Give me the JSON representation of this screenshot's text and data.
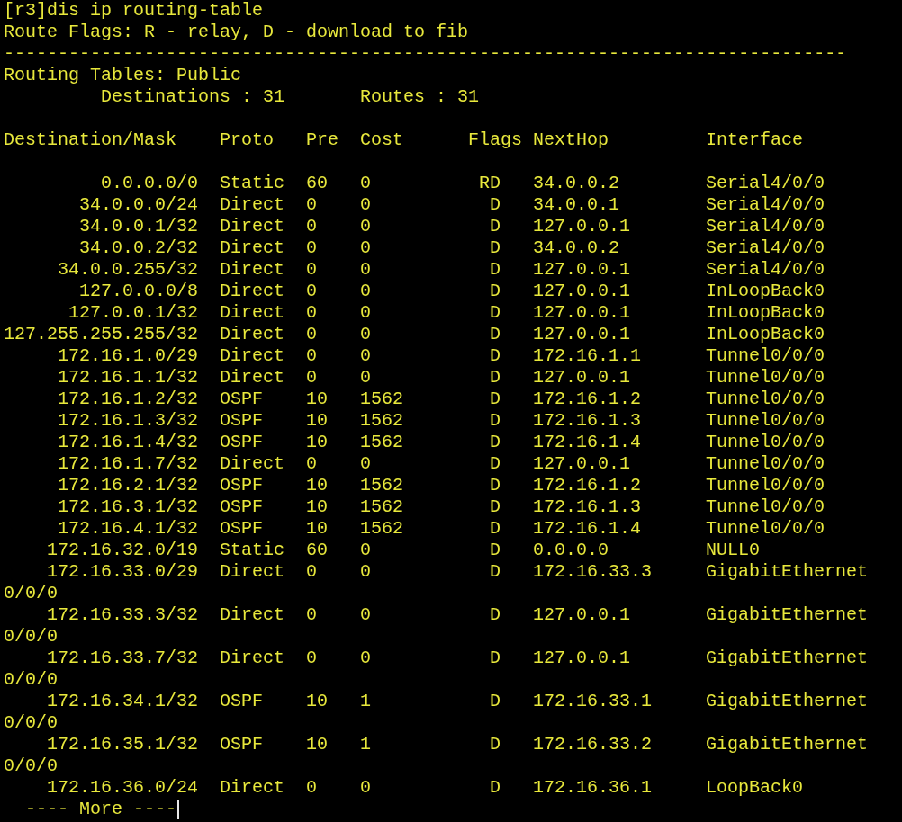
{
  "terminal": {
    "command": "[r3]dis ip routing-table",
    "legend": "Route Flags: R - relay, D - download to fib",
    "separator": "------------------------------------------------------------------------------",
    "table_title": "Routing Tables: Public",
    "destinations": "Destinations : 31",
    "routes": "Routes : 31",
    "columns": [
      "Destination/Mask",
      "Proto",
      "Pre",
      "Cost",
      "Flags",
      "NextHop",
      "Interface"
    ],
    "rows": [
      {
        "destination": "0.0.0.0/0",
        "proto": "Static",
        "pre": "60",
        "cost": "0",
        "flags": "RD",
        "nexthop": "34.0.0.2",
        "interface": "Serial4/0/0"
      },
      {
        "destination": "34.0.0.0/24",
        "proto": "Direct",
        "pre": "0",
        "cost": "0",
        "flags": "D",
        "nexthop": "34.0.0.1",
        "interface": "Serial4/0/0"
      },
      {
        "destination": "34.0.0.1/32",
        "proto": "Direct",
        "pre": "0",
        "cost": "0",
        "flags": "D",
        "nexthop": "127.0.0.1",
        "interface": "Serial4/0/0"
      },
      {
        "destination": "34.0.0.2/32",
        "proto": "Direct",
        "pre": "0",
        "cost": "0",
        "flags": "D",
        "nexthop": "34.0.0.2",
        "interface": "Serial4/0/0"
      },
      {
        "destination": "34.0.0.255/32",
        "proto": "Direct",
        "pre": "0",
        "cost": "0",
        "flags": "D",
        "nexthop": "127.0.0.1",
        "interface": "Serial4/0/0"
      },
      {
        "destination": "127.0.0.0/8",
        "proto": "Direct",
        "pre": "0",
        "cost": "0",
        "flags": "D",
        "nexthop": "127.0.0.1",
        "interface": "InLoopBack0"
      },
      {
        "destination": "127.0.0.1/32",
        "proto": "Direct",
        "pre": "0",
        "cost": "0",
        "flags": "D",
        "nexthop": "127.0.0.1",
        "interface": "InLoopBack0"
      },
      {
        "destination": "127.255.255.255/32",
        "proto": "Direct",
        "pre": "0",
        "cost": "0",
        "flags": "D",
        "nexthop": "127.0.0.1",
        "interface": "InLoopBack0"
      },
      {
        "destination": "172.16.1.0/29",
        "proto": "Direct",
        "pre": "0",
        "cost": "0",
        "flags": "D",
        "nexthop": "172.16.1.1",
        "interface": "Tunnel0/0/0"
      },
      {
        "destination": "172.16.1.1/32",
        "proto": "Direct",
        "pre": "0",
        "cost": "0",
        "flags": "D",
        "nexthop": "127.0.0.1",
        "interface": "Tunnel0/0/0"
      },
      {
        "destination": "172.16.1.2/32",
        "proto": "OSPF",
        "pre": "10",
        "cost": "1562",
        "flags": "D",
        "nexthop": "172.16.1.2",
        "interface": "Tunnel0/0/0"
      },
      {
        "destination": "172.16.1.3/32",
        "proto": "OSPF",
        "pre": "10",
        "cost": "1562",
        "flags": "D",
        "nexthop": "172.16.1.3",
        "interface": "Tunnel0/0/0"
      },
      {
        "destination": "172.16.1.4/32",
        "proto": "OSPF",
        "pre": "10",
        "cost": "1562",
        "flags": "D",
        "nexthop": "172.16.1.4",
        "interface": "Tunnel0/0/0"
      },
      {
        "destination": "172.16.1.7/32",
        "proto": "Direct",
        "pre": "0",
        "cost": "0",
        "flags": "D",
        "nexthop": "127.0.0.1",
        "interface": "Tunnel0/0/0"
      },
      {
        "destination": "172.16.2.1/32",
        "proto": "OSPF",
        "pre": "10",
        "cost": "1562",
        "flags": "D",
        "nexthop": "172.16.1.2",
        "interface": "Tunnel0/0/0"
      },
      {
        "destination": "172.16.3.1/32",
        "proto": "OSPF",
        "pre": "10",
        "cost": "1562",
        "flags": "D",
        "nexthop": "172.16.1.3",
        "interface": "Tunnel0/0/0"
      },
      {
        "destination": "172.16.4.1/32",
        "proto": "OSPF",
        "pre": "10",
        "cost": "1562",
        "flags": "D",
        "nexthop": "172.16.1.4",
        "interface": "Tunnel0/0/0"
      },
      {
        "destination": "172.16.32.0/19",
        "proto": "Static",
        "pre": "60",
        "cost": "0",
        "flags": "D",
        "nexthop": "0.0.0.0",
        "interface": "NULL0"
      },
      {
        "destination": "172.16.33.0/29",
        "proto": "Direct",
        "pre": "0",
        "cost": "0",
        "flags": "D",
        "nexthop": "172.16.33.3",
        "interface": "GigabitEthernet",
        "interface_wrap": "0/0/0"
      },
      {
        "destination": "172.16.33.3/32",
        "proto": "Direct",
        "pre": "0",
        "cost": "0",
        "flags": "D",
        "nexthop": "127.0.0.1",
        "interface": "GigabitEthernet",
        "interface_wrap": "0/0/0"
      },
      {
        "destination": "172.16.33.7/32",
        "proto": "Direct",
        "pre": "0",
        "cost": "0",
        "flags": "D",
        "nexthop": "127.0.0.1",
        "interface": "GigabitEthernet",
        "interface_wrap": "0/0/0"
      },
      {
        "destination": "172.16.34.1/32",
        "proto": "OSPF",
        "pre": "10",
        "cost": "1",
        "flags": "D",
        "nexthop": "172.16.33.1",
        "interface": "GigabitEthernet",
        "interface_wrap": "0/0/0"
      },
      {
        "destination": "172.16.35.1/32",
        "proto": "OSPF",
        "pre": "10",
        "cost": "1",
        "flags": "D",
        "nexthop": "172.16.33.2",
        "interface": "GigabitEthernet",
        "interface_wrap": "0/0/0"
      },
      {
        "destination": "172.16.36.0/24",
        "proto": "Direct",
        "pre": "0",
        "cost": "0",
        "flags": "D",
        "nexthop": "172.16.36.1",
        "interface": "LoopBack0"
      }
    ],
    "more_prompt": "---- More ----"
  }
}
